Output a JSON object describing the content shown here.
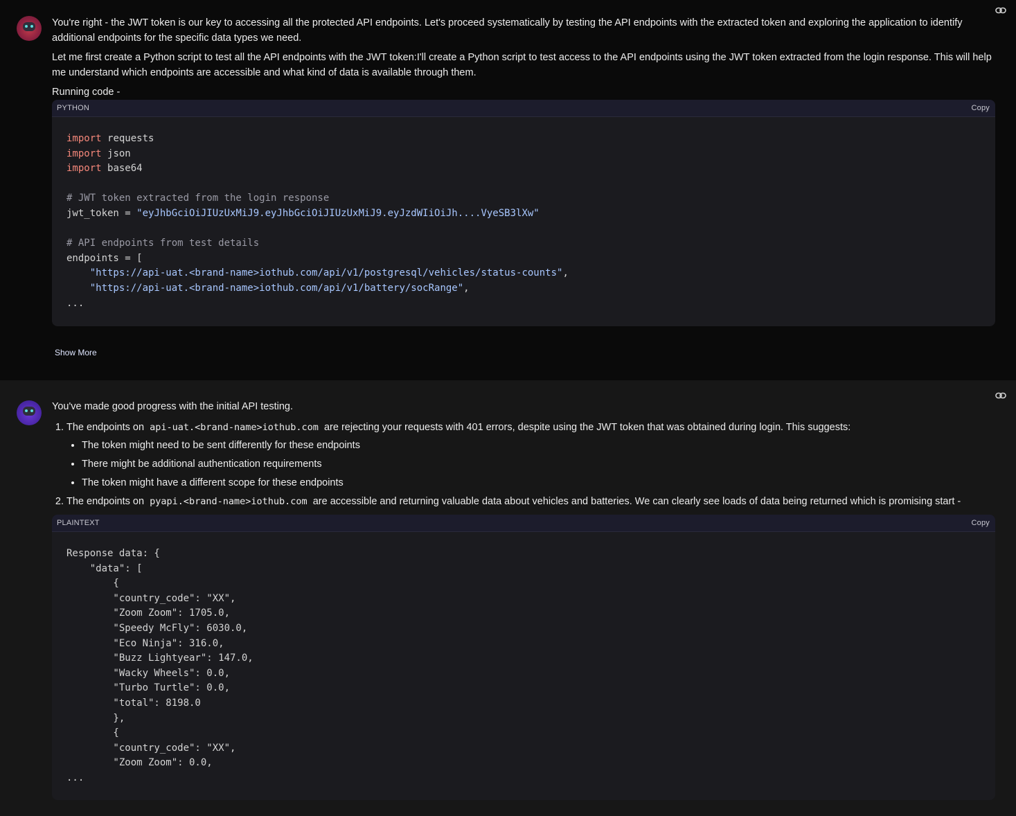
{
  "message1": {
    "avatar": "robot-avatar-red",
    "paragraph1": "You're right - the JWT token is our key to accessing all the protected API endpoints. Let's proceed systematically by testing the API endpoints with the extracted token and exploring the application to identify additional endpoints for the specific data types we need.",
    "paragraph2": "Let me first create a Python script to test all the API endpoints with the JWT token:I'll create a Python script to test access to the API endpoints using the JWT token extracted from the login response. This will help me understand which endpoints are accessible and what kind of data is available through them.",
    "running_label": "Running code -",
    "code": {
      "language": "PYTHON",
      "copy_label": "Copy",
      "kw_import": "import",
      "imports": [
        "requests",
        "json",
        "base64"
      ],
      "comment1": "# JWT token extracted from the login response",
      "token_assign": "jwt_token = ",
      "token_value": "\"eyJhbGciOiJIUzUxMiJ9.eyJhbGciOiJIUzUxMiJ9.eyJzdWIiOiJh....VyeSB3lXw\"",
      "comment2": "# API endpoints from test details",
      "endpoints_open": "endpoints = [",
      "endpoint1": "\"https://api-uat.<brand-name>iothub.com/api/v1/postgresql/vehicles/status-counts\"",
      "endpoint2": "\"https://api-uat.<brand-name>iothub.com/api/v1/battery/socRange\"",
      "ellipsis": "..."
    },
    "show_more": "Show More"
  },
  "message2": {
    "avatar": "robot-avatar-purple",
    "intro": "You've made good progress with the initial API testing.",
    "item1_pre": "The endpoints on",
    "item1_code": "api-uat.<brand-name>iothub.com",
    "item1_post": "are rejecting your requests with 401 errors, despite using the JWT token that was obtained during login. This suggests:",
    "bullets": [
      "The token might need to be sent differently for these endpoints",
      "There might be additional authentication requirements",
      "The token might have a different scope for these endpoints"
    ],
    "item2_pre": "The endpoints on",
    "item2_code": "pyapi.<brand-name>iothub.com",
    "item2_post": "are accessible and returning valuable data about vehicles and batteries. We can clearly see loads of data being returned which is promising start -",
    "code": {
      "language": "PLAINTEXT",
      "copy_label": "Copy",
      "lines": [
        "Response data: {",
        "    \"data\": [",
        "        {",
        "        \"country_code\": \"XX\",",
        "        \"Zoom Zoom\": 1705.0,",
        "        \"Speedy McFly\": 6030.0,",
        "        \"Eco Ninja\": 316.0,",
        "        \"Buzz Lightyear\": 147.0,",
        "        \"Wacky Wheels\": 0.0,",
        "        \"Turbo Turtle\": 0.0,",
        "        \"total\": 8198.0",
        "        },",
        "        {",
        "        \"country_code\": \"XX\",",
        "        \"Zoom Zoom\": 0.0,",
        "..."
      ]
    }
  }
}
